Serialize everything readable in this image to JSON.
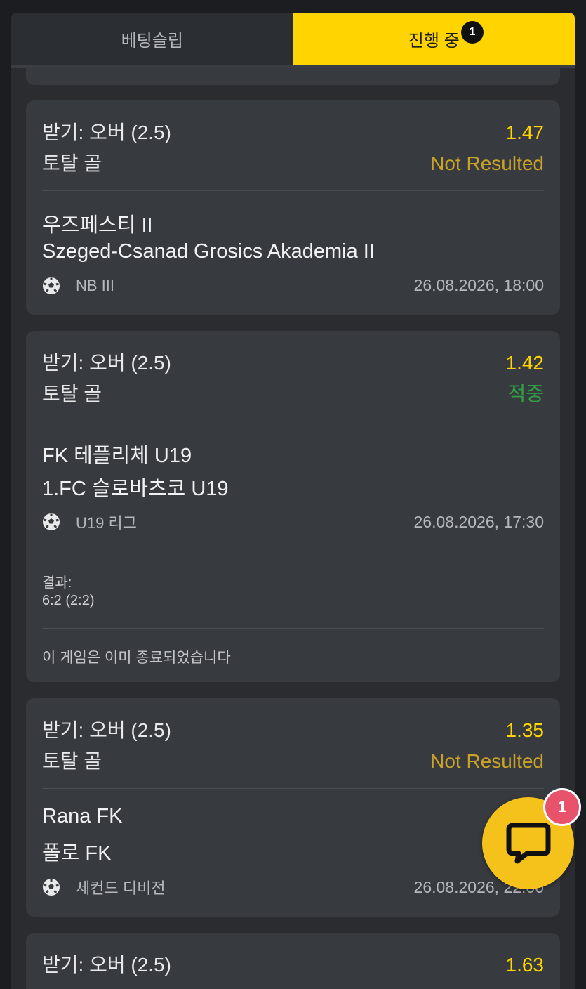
{
  "tabs": {
    "betslip_label": "베팅슬립",
    "active_label": "진행 중",
    "active_badge": "1"
  },
  "bets": [
    {
      "selection": "받기: 오버 (2.5)",
      "odds": "1.47",
      "market": "토탈 골",
      "status": "Not Resulted",
      "home": "우즈페스티 II",
      "away": "Szeged-Csanad Grosics Akademia II",
      "league": "NB III",
      "datetime": "26.08.2026, 18:00"
    },
    {
      "selection": "받기: 오버 (2.5)",
      "odds": "1.42",
      "market": "토탈 골",
      "status": "적중",
      "home": "FK 테플리체 U19",
      "away": "1.FC 슬로바츠코 U19",
      "league": "U19 리그",
      "datetime": "26.08.2026, 17:30",
      "result_label": "결과:",
      "result_value": "6:2 (2:2)",
      "ended_note": "이 게임은 이미 종료되었습니다"
    },
    {
      "selection": "받기: 오버 (2.5)",
      "odds": "1.35",
      "market": "토탈 골",
      "status": "Not Resulted",
      "home": "Rana FK",
      "away": "폴로 FK",
      "league": "세컨드 디비전",
      "datetime": "26.08.2026, 22:00"
    },
    {
      "selection": "받기: 오버 (2.5)",
      "odds": "1.63"
    }
  ],
  "chat": {
    "icon": "chat-bubble-icon",
    "badge": "1"
  },
  "colors": {
    "accent": "#ffd400",
    "not_resulted": "#c9a227",
    "won": "#2f9e44",
    "card": "#373a3f"
  }
}
